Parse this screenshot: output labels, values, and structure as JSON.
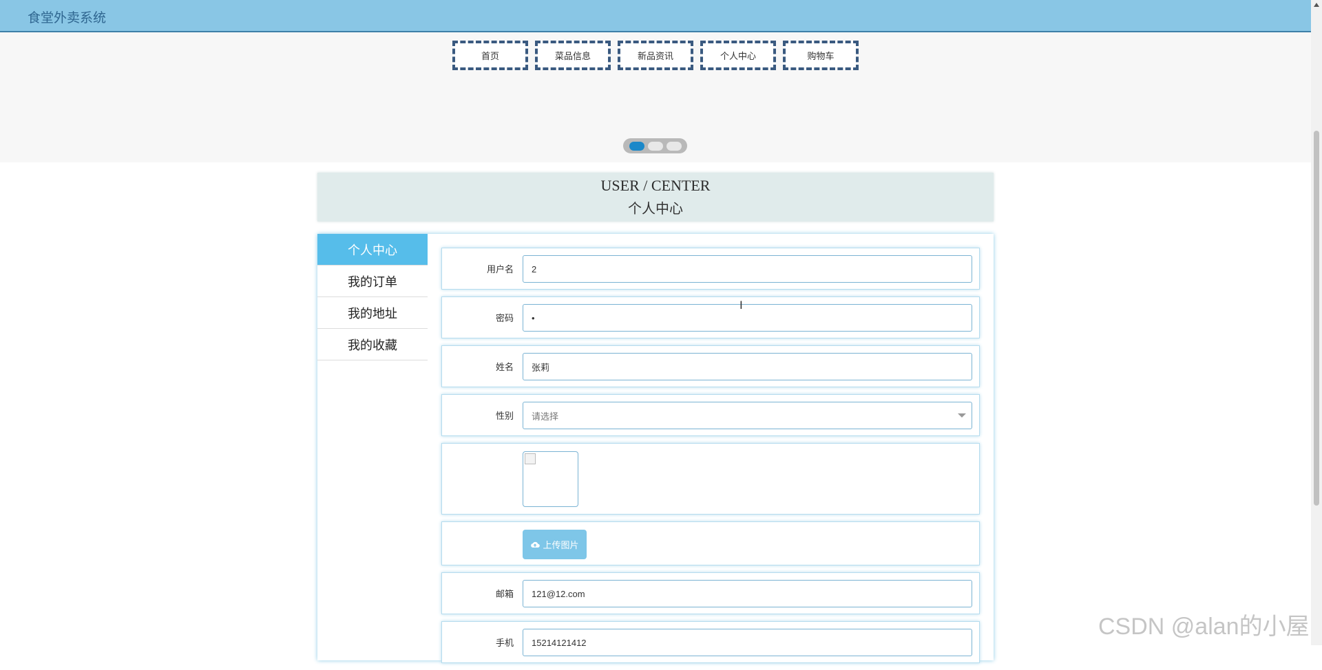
{
  "app": {
    "title": "食堂外卖系统"
  },
  "nav": [
    "首页",
    "菜品信息",
    "新品资讯",
    "个人中心",
    "购物车"
  ],
  "carousel": {
    "dots": 3,
    "active": 0
  },
  "user_center": {
    "title_en": "USER / CENTER",
    "title_cn": "个人中心"
  },
  "sidebar": {
    "items": [
      "个人中心",
      "我的订单",
      "我的地址",
      "我的收藏"
    ],
    "active": 0
  },
  "form": {
    "username_label": "用户名",
    "username_value": "2",
    "password_label": "密码",
    "password_value": "•",
    "name_label": "姓名",
    "name_value": "张莉",
    "gender_label": "性别",
    "gender_placeholder": "请选择",
    "upload_label": "上传图片",
    "email_label": "邮箱",
    "email_value": "121@12.com",
    "phone_label": "手机",
    "phone_value": "15214121412"
  },
  "watermark": "CSDN @alan的小屋",
  "colors": {
    "topbar": "#89c6e5",
    "accent": "#56bdea",
    "nav_border": "#3a5a80"
  }
}
